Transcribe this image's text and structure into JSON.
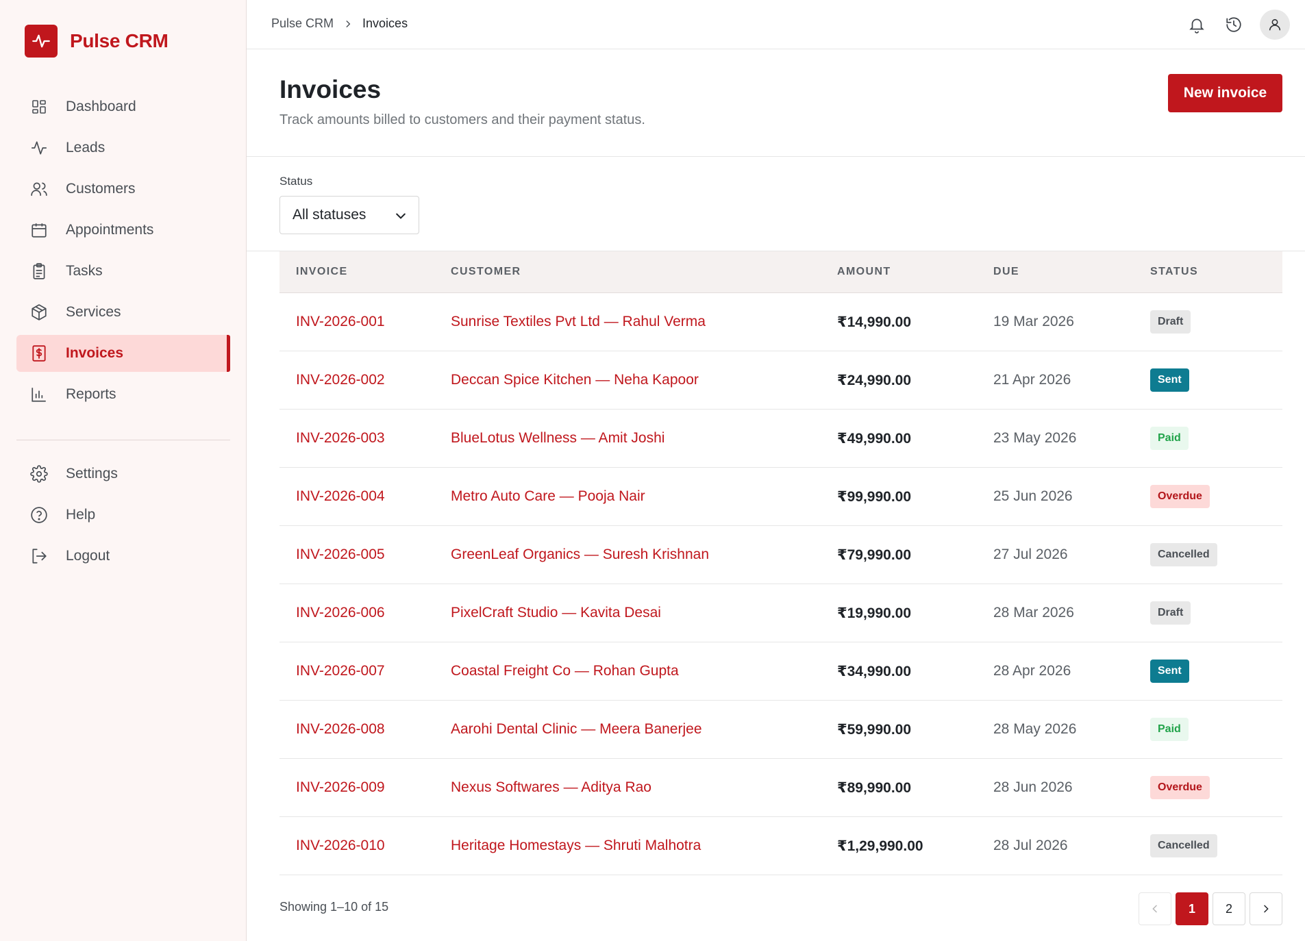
{
  "brand": {
    "name": "Pulse CRM"
  },
  "nav": {
    "items": [
      {
        "label": "Dashboard",
        "icon": "dashboard-icon"
      },
      {
        "label": "Leads",
        "icon": "activity-icon"
      },
      {
        "label": "Customers",
        "icon": "users-icon"
      },
      {
        "label": "Appointments",
        "icon": "calendar-icon"
      },
      {
        "label": "Tasks",
        "icon": "clipboard-icon"
      },
      {
        "label": "Services",
        "icon": "box-icon"
      },
      {
        "label": "Invoices",
        "icon": "invoice-icon",
        "active": true
      },
      {
        "label": "Reports",
        "icon": "bar-chart-icon"
      }
    ],
    "secondary": [
      {
        "label": "Settings",
        "icon": "gear-icon"
      },
      {
        "label": "Help",
        "icon": "help-icon"
      },
      {
        "label": "Logout",
        "icon": "logout-icon"
      }
    ]
  },
  "breadcrumb": {
    "root": "Pulse CRM",
    "current": "Invoices"
  },
  "header": {
    "title": "Invoices",
    "subtitle": "Track amounts billed to customers and their payment status.",
    "new_button": "New invoice"
  },
  "filter": {
    "label": "Status",
    "selected": "All statuses"
  },
  "table": {
    "columns": [
      "INVOICE",
      "CUSTOMER",
      "AMOUNT",
      "DUE",
      "STATUS"
    ],
    "rows": [
      {
        "invoice": "INV-2026-001",
        "customer": "Sunrise Textiles Pvt Ltd — Rahul Verma",
        "amount": "₹14,990.00",
        "due": "19 Mar 2026",
        "status": "Draft"
      },
      {
        "invoice": "INV-2026-002",
        "customer": "Deccan Spice Kitchen — Neha Kapoor",
        "amount": "₹24,990.00",
        "due": "21 Apr 2026",
        "status": "Sent"
      },
      {
        "invoice": "INV-2026-003",
        "customer": "BlueLotus Wellness — Amit Joshi",
        "amount": "₹49,990.00",
        "due": "23 May 2026",
        "status": "Paid"
      },
      {
        "invoice": "INV-2026-004",
        "customer": "Metro Auto Care — Pooja Nair",
        "amount": "₹99,990.00",
        "due": "25 Jun 2026",
        "status": "Overdue"
      },
      {
        "invoice": "INV-2026-005",
        "customer": "GreenLeaf Organics — Suresh Krishnan",
        "amount": "₹79,990.00",
        "due": "27 Jul 2026",
        "status": "Cancelled"
      },
      {
        "invoice": "INV-2026-006",
        "customer": "PixelCraft Studio — Kavita Desai",
        "amount": "₹19,990.00",
        "due": "28 Mar 2026",
        "status": "Draft"
      },
      {
        "invoice": "INV-2026-007",
        "customer": "Coastal Freight Co — Rohan Gupta",
        "amount": "₹34,990.00",
        "due": "28 Apr 2026",
        "status": "Sent"
      },
      {
        "invoice": "INV-2026-008",
        "customer": "Aarohi Dental Clinic — Meera Banerjee",
        "amount": "₹59,990.00",
        "due": "28 May 2026",
        "status": "Paid"
      },
      {
        "invoice": "INV-2026-009",
        "customer": "Nexus Softwares — Aditya Rao",
        "amount": "₹89,990.00",
        "due": "28 Jun 2026",
        "status": "Overdue"
      },
      {
        "invoice": "INV-2026-010",
        "customer": "Heritage Homestays — Shruti Malhotra",
        "amount": "₹1,29,990.00",
        "due": "28 Jul 2026",
        "status": "Cancelled"
      }
    ]
  },
  "footer": {
    "showing": "Showing 1–10 of 15",
    "pages": [
      "1",
      "2"
    ],
    "current_page": "1"
  },
  "colors": {
    "accent": "#c0171d",
    "sent": "#0e7c91",
    "paid": "#21a34a"
  }
}
